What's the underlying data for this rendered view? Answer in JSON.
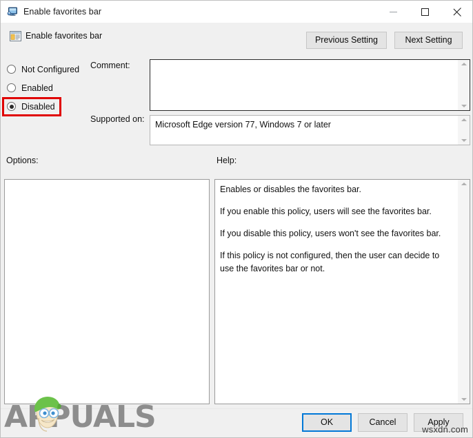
{
  "window": {
    "title": "Enable favorites bar",
    "icon": "computer-monitor-icon",
    "minimize_label": "Minimize",
    "maximize_label": "Maximize",
    "close_label": "Close"
  },
  "header": {
    "policy_title": "Enable favorites bar",
    "icon": "policy-window-icon",
    "previous_setting": "Previous Setting",
    "next_setting": "Next Setting"
  },
  "state_options": [
    {
      "label": "Not Configured",
      "selected": false
    },
    {
      "label": "Enabled",
      "selected": false
    },
    {
      "label": "Disabled",
      "selected": true
    }
  ],
  "highlight": {
    "target": "Disabled",
    "color": "#e00000"
  },
  "fields": {
    "comment_label": "Comment:",
    "comment_value": "",
    "supported_label": "Supported on:",
    "supported_value": "Microsoft Edge version 77, Windows 7 or later"
  },
  "panels": {
    "options_label": "Options:",
    "options_content": "",
    "help_label": "Help:",
    "help_paragraphs": [
      "Enables or disables the favorites bar.",
      "If you enable this policy, users will see the favorites bar.",
      "If you disable this policy, users won't see the favorites bar.",
      "If this policy is not configured, then the user can decide to use the favorites bar or not."
    ]
  },
  "footer": {
    "ok": "OK",
    "cancel": "Cancel",
    "apply": "Apply",
    "default_button": "OK"
  },
  "watermarks": {
    "brand": "APPUALS",
    "site": "wsxdn.com"
  },
  "colors": {
    "accent": "#0078d7",
    "highlight": "#e00000",
    "dialog_bg": "#f0f0f0",
    "titlebar_bg": "#ffffff",
    "brand_gray": "#8d8d8d"
  }
}
